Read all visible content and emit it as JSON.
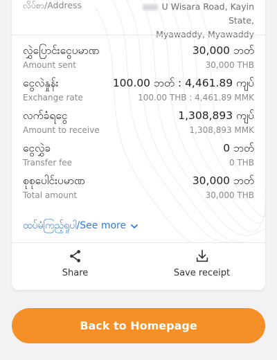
{
  "address": {
    "label": "လိပ်စာ/Address",
    "value_line1": "U Wisara Road, Kayin State,",
    "value_line2": "Myawaddy, Myawaddy"
  },
  "details": [
    {
      "label_my": "လွှဲပြောင်းငွေပမာဏ",
      "label_en": "Amount sent",
      "value_my": "30,000 ဘတ်",
      "value_en": "30,000 THB"
    },
    {
      "label_my": "ငွေလဲနှုန်း",
      "label_en": "Exchange rate",
      "value_my": "100.00 ဘတ် : 4,461.89 ကျပ်",
      "value_en": "100.00 THB : 4,461.89 MMK"
    },
    {
      "label_my": "လက်ခံရငွေ",
      "label_en": "Amount to receive",
      "value_my": "1,308,893 ကျပ်",
      "value_en": "1,308,893 MMK"
    },
    {
      "label_my": "ငွေလွှဲခ",
      "label_en": "Transfer fee",
      "value_my": "0 ဘတ်",
      "value_en": "0 THB"
    },
    {
      "label_my": "စုစုပေါင်းပမာဏ",
      "label_en": "Total amount",
      "value_my": "30,000 ဘတ်",
      "value_en": "30,000 THB"
    }
  ],
  "see_more": {
    "label": "ထပ်မံကြည့်ရှုပါ/See more",
    "icon": "chevron-down-icon"
  },
  "actions": {
    "share_label": "Share",
    "share_icon": "share-icon",
    "save_label": "Save receipt",
    "save_icon": "download-icon"
  },
  "cta": {
    "label": "Back to Homepage"
  },
  "colors": {
    "accent": "#f58f27",
    "link": "#2a7de1",
    "muted_text": "#8a8a8a",
    "background": "#f2f2f4"
  }
}
